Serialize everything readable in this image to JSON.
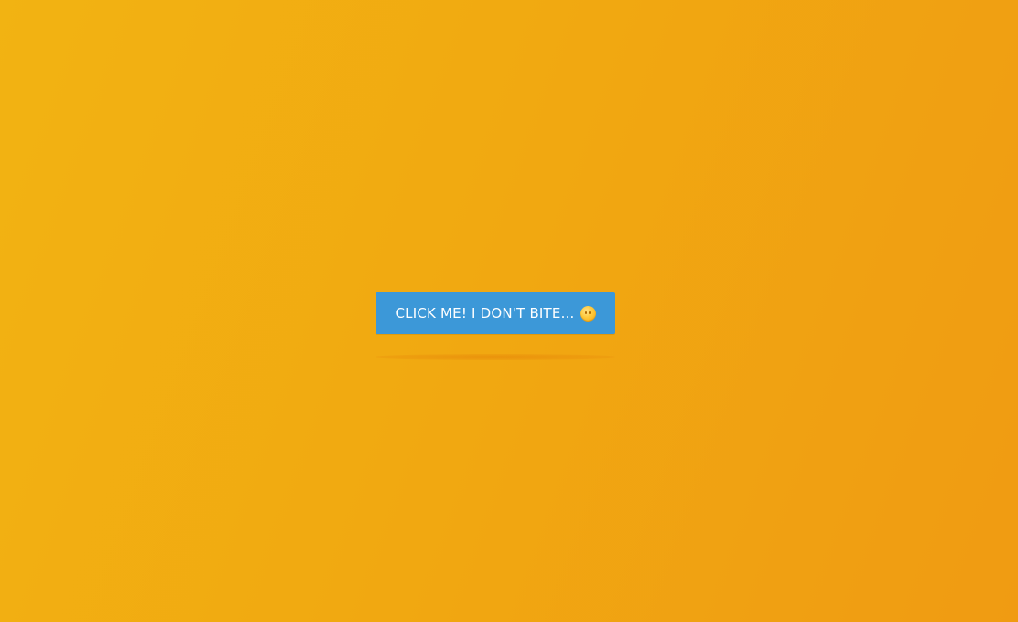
{
  "page": {
    "background_colors": [
      "#f2b312",
      "#f1a911",
      "#f09b12"
    ]
  },
  "cta": {
    "label": "CLICK ME! I DON'T BITE...",
    "icon": "smiley-emoji-icon",
    "color": "#3c98d8",
    "text_color": "#ffffff"
  }
}
